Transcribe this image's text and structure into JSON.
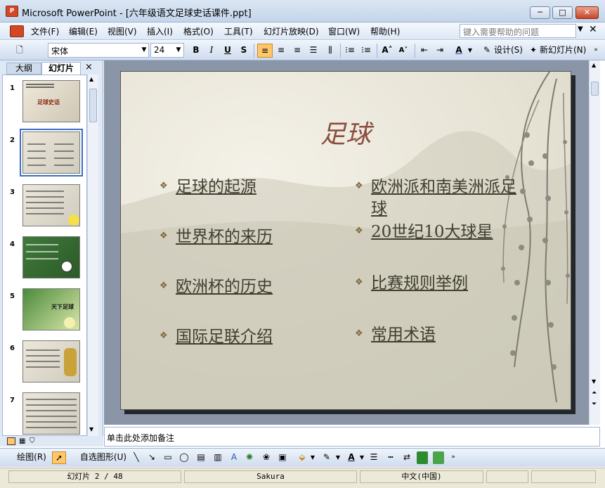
{
  "window": {
    "app_icon": "P",
    "title": "Microsoft PowerPoint - [六年级语文足球史话课件.ppt]",
    "minimize": "─",
    "maximize": "□",
    "close": "✕"
  },
  "menu": {
    "items": [
      "文件(F)",
      "编辑(E)",
      "视图(V)",
      "插入(I)",
      "格式(O)",
      "工具(T)",
      "幻灯片放映(D)",
      "窗口(W)",
      "帮助(H)"
    ],
    "help_placeholder": "键入需要帮助的问题"
  },
  "toolbar": {
    "font_name": "宋体",
    "font_size": "24",
    "bold": "B",
    "italic": "I",
    "underline": "U",
    "shadow": "S",
    "font_grow": "A˄",
    "font_shrink": "A˅",
    "font_color": "A",
    "design_label": "设计(S)",
    "new_slide_label": "新幻灯片(N)"
  },
  "left_pane": {
    "tab_outline": "大纲",
    "tab_slides": "幻灯片",
    "close": "×",
    "slide_numbers": [
      "1",
      "2",
      "3",
      "4",
      "5",
      "6",
      "7"
    ],
    "thumb1_title": "足球史话",
    "thumb5_title": "天下足球"
  },
  "slide": {
    "title": "足球",
    "bullets_left": [
      "足球的起源",
      "世界杯的来历",
      "欧洲杯的历史",
      "国际足联介绍"
    ],
    "bullets_right": [
      "欧洲派和南美洲派足",
      "球",
      "20世纪10大球星",
      "比赛规则举例",
      "常用术语"
    ],
    "bullet_mark": "❖"
  },
  "notes": {
    "placeholder": "单击此处添加备注"
  },
  "drawing_toolbar": {
    "draw_label": "绘图(R)",
    "autoshapes_label": "自选图形(U)"
  },
  "status": {
    "slide_position": "幻灯片 2 / 48",
    "design_template": "Sakura",
    "language": "中文(中国)"
  },
  "colors": {
    "accent_orange": "#ffc66a",
    "title_color": "#8a4d3e",
    "bullet_text": "#3f3f2f"
  }
}
